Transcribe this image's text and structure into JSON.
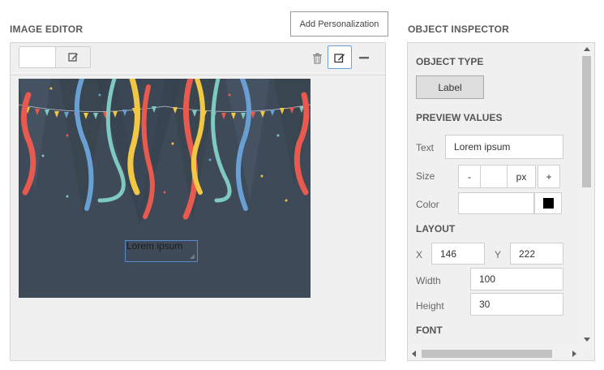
{
  "editor": {
    "title": "IMAGE EDITOR",
    "tooltip": "Add Personalization",
    "label_preview_text": "Lorem ipsum"
  },
  "inspector": {
    "title": "OBJECT INSPECTOR",
    "object_type": {
      "heading": "OBJECT TYPE",
      "button": "Label"
    },
    "preview": {
      "heading": "PREVIEW VALUES",
      "text_label": "Text",
      "text_value": "Lorem ipsum",
      "size_label": "Size",
      "size_minus": "-",
      "size_value": "",
      "size_unit": "px",
      "size_plus": "+",
      "color_label": "Color",
      "color_value": "",
      "color_swatch": "#000000"
    },
    "layout": {
      "heading": "LAYOUT",
      "x_label": "X",
      "x_value": "146",
      "y_label": "Y",
      "y_value": "222",
      "width_label": "Width",
      "width_value": "100",
      "height_label": "Height",
      "height_value": "30"
    },
    "font": {
      "heading": "FONT"
    }
  },
  "icons": {
    "trash": "trash-icon",
    "edit": "edit-icon",
    "minimize": "minimize-icon"
  },
  "colors": {
    "canvas_bg": "#3e4a58",
    "selection_border": "#5a8acb",
    "active_button_border": "#6aa0e0"
  }
}
